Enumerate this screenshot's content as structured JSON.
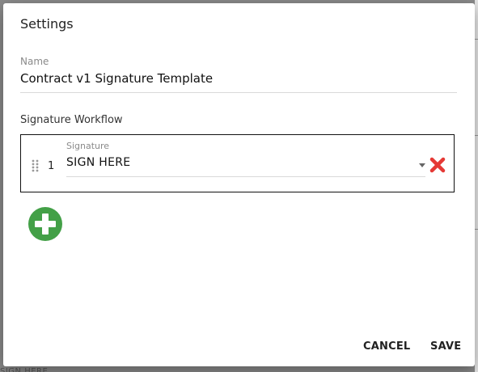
{
  "dialog": {
    "title": "Settings",
    "name_label": "Name",
    "name_value": "Contract v1 Signature Template",
    "workflow_label": "Signature Workflow"
  },
  "workflow": {
    "steps": [
      {
        "number": "1",
        "field_label": "Signature",
        "value": "SIGN HERE"
      }
    ]
  },
  "actions": {
    "cancel_label": "CANCEL",
    "save_label": "SAVE"
  },
  "background": {
    "partial_text": "SIGN HERE"
  },
  "icons": {
    "drag": "drag-handle-icon",
    "remove": "close-x-icon",
    "add": "plus-circle-icon",
    "dropdown": "chevron-down-icon"
  },
  "colors": {
    "remove_red": "#e53935",
    "add_green": "#43a047",
    "overlay": "#8a8a8a"
  }
}
